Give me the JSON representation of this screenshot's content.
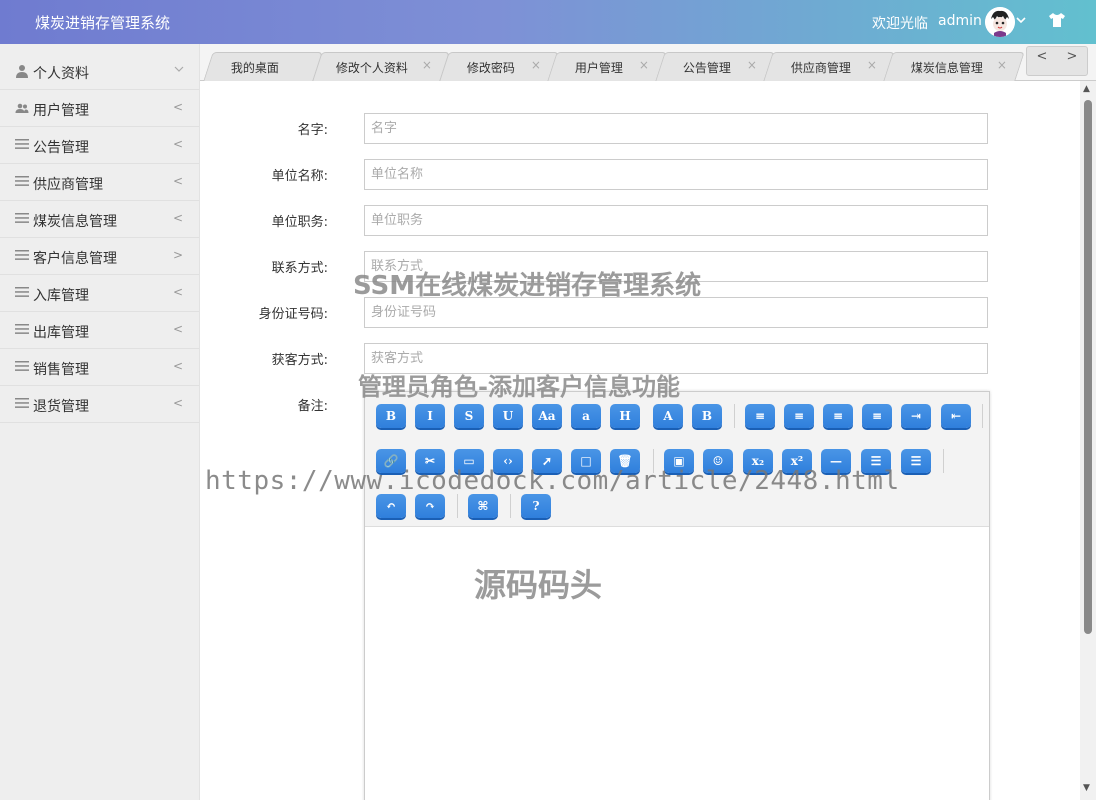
{
  "header": {
    "app_title": "煤炭进销存管理系统",
    "welcome": "欢迎光临",
    "username": "admin",
    "avatar_dropdown_icon": "chevron-down-icon",
    "theme_icon": "tshirt-icon",
    "gradient_from": "#6f7bd0",
    "gradient_to": "#62c0cf"
  },
  "sidebar": {
    "items": [
      {
        "label": "个人资料",
        "icon": "user-icon",
        "arrow": "﹀"
      },
      {
        "label": "用户管理",
        "icon": "users-icon",
        "arrow": "<"
      },
      {
        "label": "公告管理",
        "icon": "list-icon",
        "arrow": "<"
      },
      {
        "label": "供应商管理",
        "icon": "list-icon",
        "arrow": "<"
      },
      {
        "label": "煤炭信息管理",
        "icon": "list-icon",
        "arrow": "<"
      },
      {
        "label": "客户信息管理",
        "icon": "list-icon",
        "arrow": ">"
      },
      {
        "label": "入库管理",
        "icon": "list-icon",
        "arrow": "<"
      },
      {
        "label": "出库管理",
        "icon": "list-icon",
        "arrow": "<"
      },
      {
        "label": "销售管理",
        "icon": "list-icon",
        "arrow": "<"
      },
      {
        "label": "退货管理",
        "icon": "list-icon",
        "arrow": "<"
      }
    ]
  },
  "tabs": [
    {
      "label": "我的桌面",
      "closable": false
    },
    {
      "label": "修改个人资料",
      "closable": true
    },
    {
      "label": "修改密码",
      "closable": true
    },
    {
      "label": "用户管理",
      "closable": true
    },
    {
      "label": "公告管理",
      "closable": true
    },
    {
      "label": "供应商管理",
      "closable": true
    },
    {
      "label": "煤炭信息管理",
      "closable": true
    }
  ],
  "tab_nav": {
    "prev": "<",
    "next": ">"
  },
  "form": {
    "fields": [
      {
        "label": "名字:",
        "placeholder": "名字",
        "value": ""
      },
      {
        "label": "单位名称:",
        "placeholder": "单位名称",
        "value": ""
      },
      {
        "label": "单位职务:",
        "placeholder": "单位职务",
        "value": ""
      },
      {
        "label": "联系方式:",
        "placeholder": "联系方式",
        "value": ""
      },
      {
        "label": "身份证号码:",
        "placeholder": "身份证号码",
        "value": ""
      },
      {
        "label": "获客方式:",
        "placeholder": "获客方式",
        "value": ""
      }
    ],
    "remark_label": "备注:"
  },
  "editor": {
    "button_color": "#2f7fdc",
    "buttons": [
      {
        "name": "bold-icon",
        "glyph": "B"
      },
      {
        "name": "italic-icon",
        "glyph": "I"
      },
      {
        "name": "strikethrough-icon",
        "glyph": "S"
      },
      {
        "name": "underline-icon",
        "glyph": "U"
      },
      {
        "name": "font-size-icon",
        "glyph": "Aa"
      },
      {
        "name": "font-family-icon",
        "glyph": "a"
      },
      {
        "name": "heading-icon",
        "glyph": "H"
      },
      {
        "name": "font-color-icon",
        "glyph": "A"
      },
      {
        "name": "background-color-icon",
        "glyph": "B"
      },
      {
        "name": "align-center-icon",
        "glyph": "≡"
      },
      {
        "name": "align-left-icon",
        "glyph": "≡"
      },
      {
        "name": "align-right-icon",
        "glyph": "≡"
      },
      {
        "name": "align-justify-icon",
        "glyph": "≡"
      },
      {
        "name": "indent-icon",
        "glyph": "⇥"
      },
      {
        "name": "outdent-icon",
        "glyph": "⇤"
      },
      {
        "name": "link-icon",
        "glyph": "🔗"
      },
      {
        "name": "unlink-icon",
        "glyph": "✂"
      },
      {
        "name": "embed-icon",
        "glyph": "▭"
      },
      {
        "name": "code-icon",
        "glyph": "‹›"
      },
      {
        "name": "cursor-icon",
        "glyph": "➚"
      },
      {
        "name": "fullscreen-icon",
        "glyph": "□"
      },
      {
        "name": "clear-icon",
        "glyph": "🗑"
      },
      {
        "name": "image-icon",
        "glyph": "▣"
      },
      {
        "name": "emoji-icon",
        "glyph": "☺"
      },
      {
        "name": "subscript-icon",
        "glyph": "x₂"
      },
      {
        "name": "superscript-icon",
        "glyph": "x²"
      },
      {
        "name": "horizontal-rule-icon",
        "glyph": "—"
      },
      {
        "name": "ordered-list-icon",
        "glyph": "☰"
      },
      {
        "name": "unordered-list-icon",
        "glyph": "☰"
      },
      {
        "name": "undo-icon",
        "glyph": "↶"
      },
      {
        "name": "redo-icon",
        "glyph": "↷"
      },
      {
        "name": "source-code-icon",
        "glyph": "⌘"
      },
      {
        "name": "help-icon",
        "glyph": "?"
      }
    ]
  },
  "watermarks": {
    "line1": "SSM在线煤炭进销存管理系统",
    "line2": "管理员角色-添加客户信息功能",
    "line3": "https://www.icodedock.com/article/2448.html",
    "line4": "源码码头"
  }
}
